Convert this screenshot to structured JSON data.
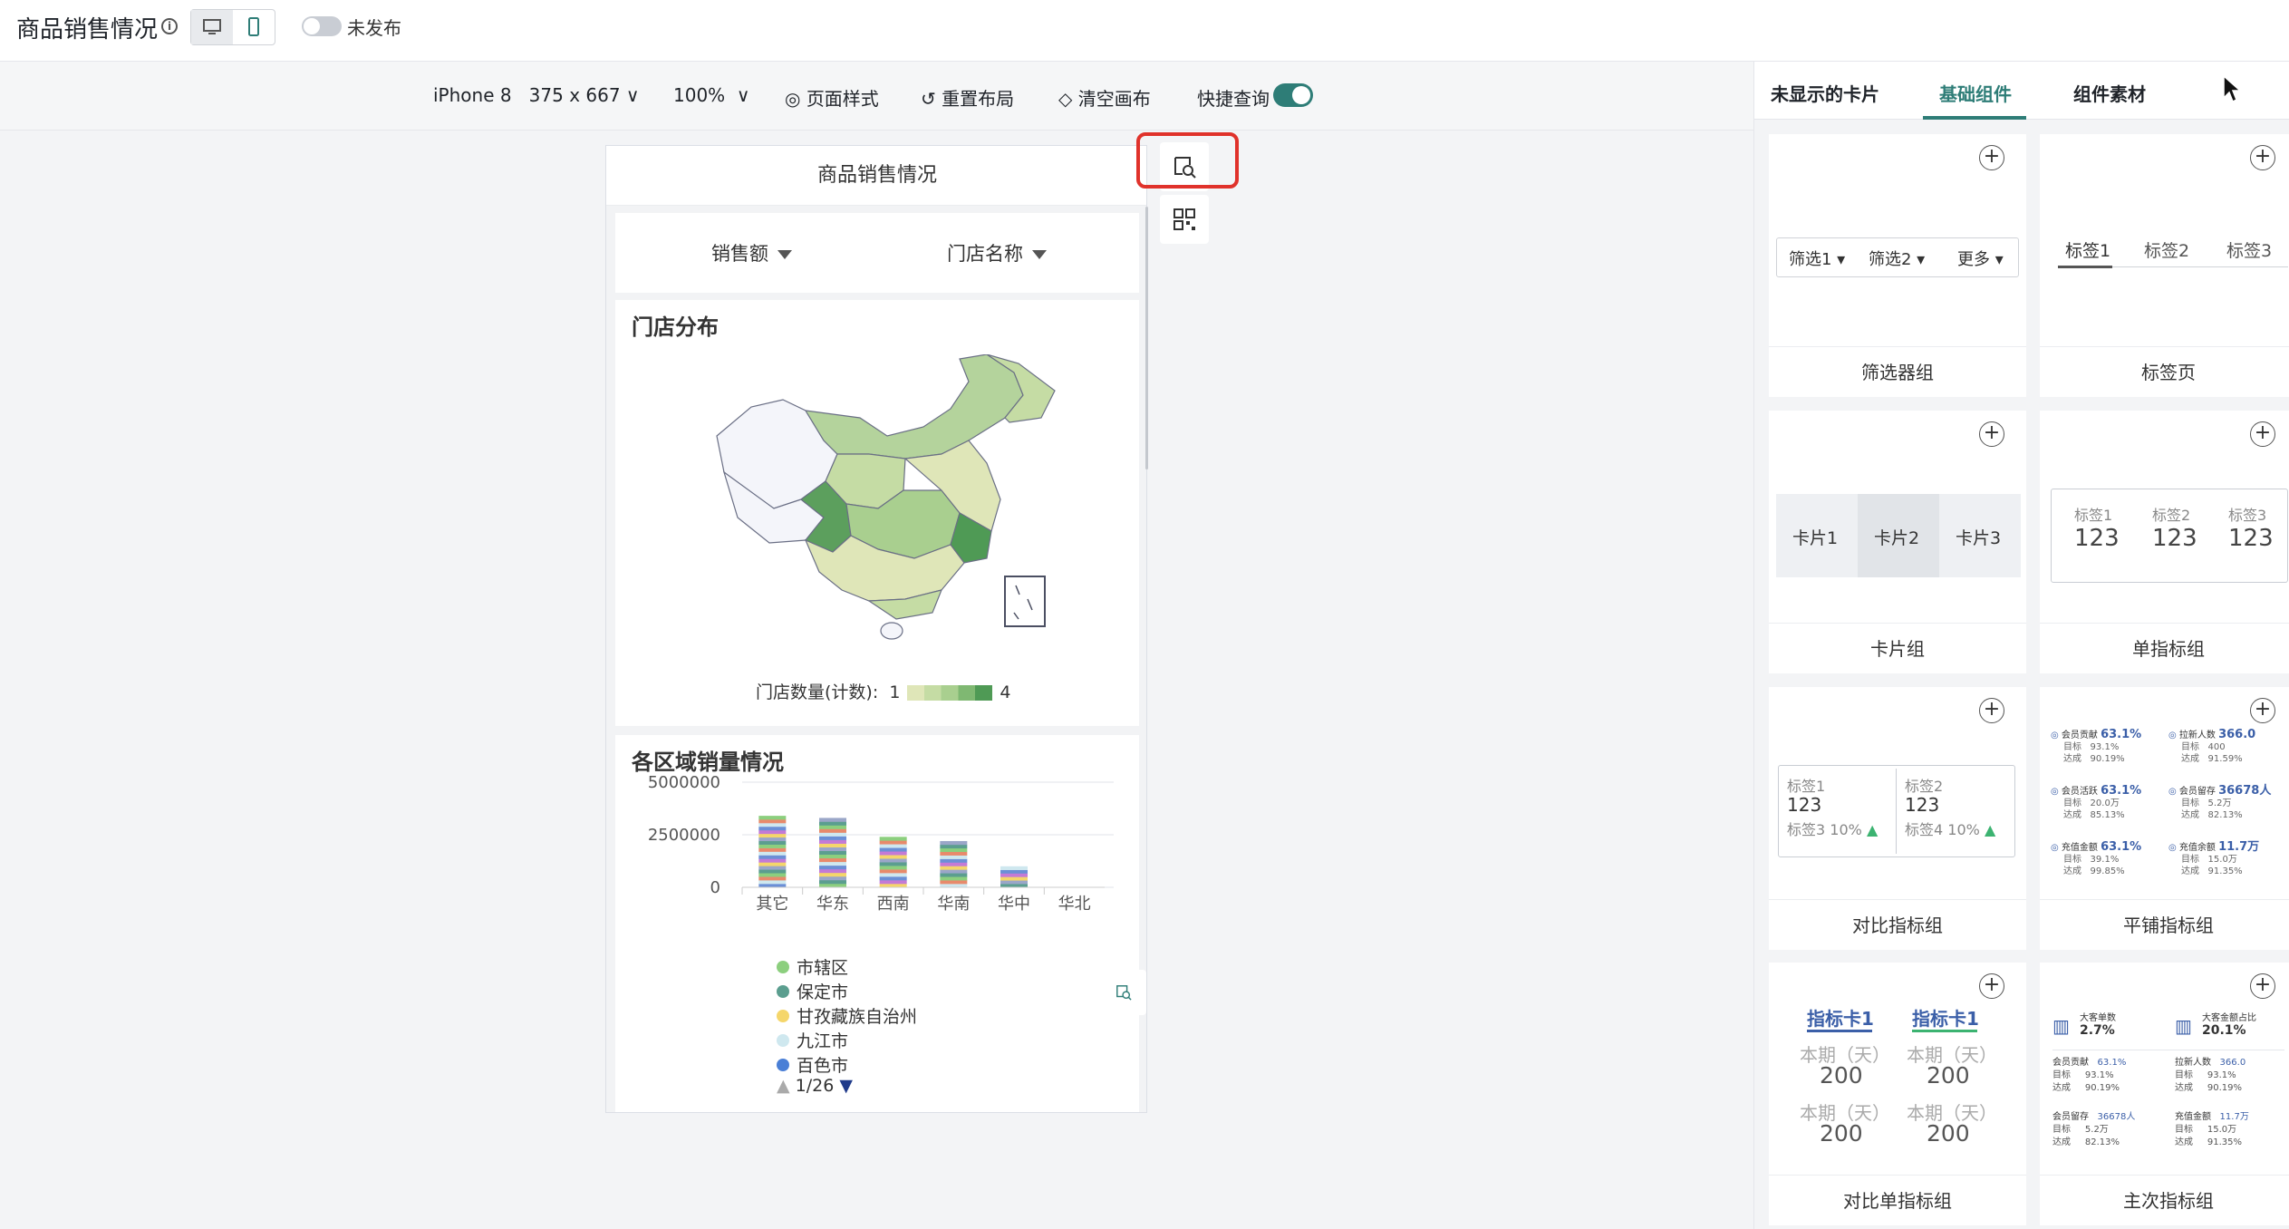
{
  "header": {
    "title": "商品销售情况",
    "info_icon": "info-icon",
    "device_switch": [
      "desktop-icon",
      "mobile-icon"
    ],
    "publish_status": "未发布"
  },
  "toolbar": {
    "device": "iPhone 8",
    "resolution": "375 x 667",
    "zoom": "100%",
    "page_style": "页面样式",
    "reset_layout": "重置布局",
    "clear_canvas": "清空画布",
    "quick_query": "快捷查询",
    "quick_query_on": true
  },
  "phone": {
    "title": "商品销售情况",
    "filters": [
      "销售额",
      "门店名称"
    ],
    "map_card": {
      "title": "门店分布",
      "legend_label": "门店数量(计数):",
      "legend_min": "1",
      "legend_max": "4"
    },
    "bar_card": {
      "title": "各区域销量情况",
      "legend": [
        {
          "name": "市辖区",
          "color": "#8ccf7e"
        },
        {
          "name": "保定市",
          "color": "#5b9e8f"
        },
        {
          "name": "甘孜藏族自治州",
          "color": "#f5d66b"
        },
        {
          "name": "九江市",
          "color": "#cfe8ef"
        },
        {
          "name": "百色市",
          "color": "#4a7fd6"
        }
      ],
      "pager": "1/26"
    }
  },
  "chart_data": {
    "type": "bar",
    "categories": [
      "其它",
      "华东",
      "西南",
      "华南",
      "华中",
      "华北"
    ],
    "values": [
      3400000,
      3300000,
      2400000,
      2200000,
      1000000,
      0
    ],
    "yticks": [
      "5000000",
      "2500000",
      "0"
    ],
    "ylim": [
      0,
      5000000
    ]
  },
  "float_tools": [
    "screen-query-icon",
    "qr-grid-icon"
  ],
  "right_panel": {
    "tabs": [
      "未显示的卡片",
      "基础组件",
      "组件素材"
    ],
    "active_tab": 1,
    "components": [
      {
        "label": "筛选器组",
        "preview": [
          "筛选1",
          "筛选2",
          "更多"
        ]
      },
      {
        "label": "标签页",
        "preview": [
          "标签1",
          "标签2",
          "标签3"
        ]
      },
      {
        "label": "卡片组",
        "preview": [
          "卡片1",
          "卡片2",
          "卡片3"
        ]
      },
      {
        "label": "单指标组",
        "preview": [
          {
            "name": "标签1",
            "value": "123"
          },
          {
            "name": "标签2",
            "value": "123"
          },
          {
            "name": "标签3",
            "value": "123"
          }
        ]
      },
      {
        "label": "对比指标组",
        "preview": [
          {
            "name": "标签1",
            "value": "123",
            "sub": "标签3 10%"
          },
          {
            "name": "标签2",
            "value": "123",
            "sub": "标签4 10%"
          }
        ]
      },
      {
        "label": "平铺指标组",
        "preview": [
          {
            "name": "会员贡献",
            "value": "63.1%",
            "l1": "目标",
            "v1": "93.1%",
            "l2": "达成",
            "v2": "90.19%"
          },
          {
            "name": "拉新人数",
            "value": "366.0",
            "l1": "目标",
            "v1": "400",
            "l2": "达成",
            "v2": "91.59%"
          },
          {
            "name": "会员活跃",
            "value": "63.1%",
            "l1": "目标",
            "v1": "20.0万",
            "l2": "达成",
            "v2": "85.13%"
          },
          {
            "name": "会员留存",
            "value": "36678人",
            "l1": "目标",
            "v1": "5.2万",
            "l2": "达成",
            "v2": "82.13%"
          },
          {
            "name": "充值金额",
            "value": "63.1%",
            "l1": "目标",
            "v1": "39.1%",
            "l2": "达成",
            "v2": "99.85%"
          },
          {
            "name": "充值余额",
            "value": "11.7万",
            "l1": "目标",
            "v1": "15.0万",
            "l2": "达成",
            "v2": "91.35%"
          }
        ]
      },
      {
        "label": "对比单指标组",
        "preview": [
          {
            "name": "指标卡1",
            "p1": "本期（天）",
            "v1": "200",
            "p2": "本期（天）",
            "v2": "200"
          },
          {
            "name": "指标卡1",
            "p1": "本期（天）",
            "v1": "200",
            "p2": "本期（天）",
            "v2": "200"
          }
        ]
      },
      {
        "label": "主次指标组",
        "preview": {
          "main": [
            {
              "name": "大客单数",
              "value": "2.7%"
            },
            {
              "name": "大客金额占比",
              "value": "20.1%"
            }
          ],
          "sub": [
            {
              "name": "会员贡献",
              "value": "63.1%",
              "v1": "93.1%",
              "v2": "90.19%"
            },
            {
              "name": "拉新人数",
              "value": "366.0",
              "v1": "93.1%",
              "v2": "90.19%"
            },
            {
              "name": "会员留存",
              "value": "36678人",
              "v1": "5.2万",
              "v2": "82.13%"
            },
            {
              "name": "充值金额",
              "value": "11.7万",
              "v1": "15.0万",
              "v2": "91.35%"
            }
          ],
          "l1": "目标",
          "l2": "达成"
        }
      }
    ]
  }
}
